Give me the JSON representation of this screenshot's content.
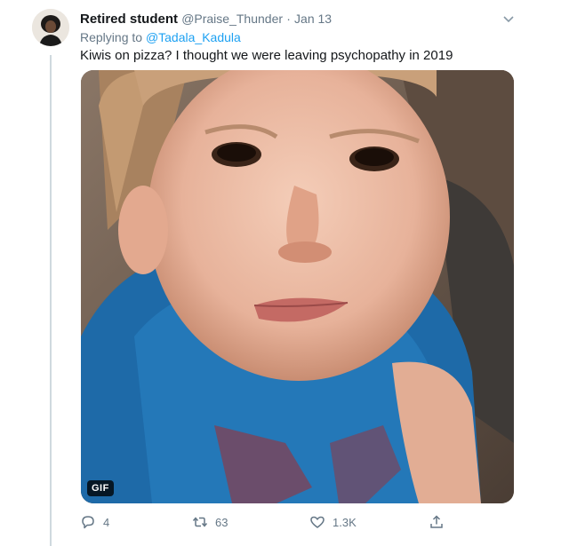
{
  "tweet": {
    "display_name": "Retired student",
    "handle": "@Praise_Thunder",
    "separator": "·",
    "date": "Jan 13",
    "reply_prefix": "Replying to",
    "reply_to": "@Tadala_Kadula",
    "text": "Kiwis on pizza? I thought we were leaving psychopathy in 2019",
    "media": {
      "badge": "GIF",
      "description_icon": "gif-media"
    }
  },
  "actions": {
    "reply_count": "4",
    "retweet_count": "63",
    "like_count": "1.3K",
    "share_label": ""
  },
  "icons": {
    "reply": "reply-icon",
    "retweet": "retweet-icon",
    "like": "heart-icon",
    "share": "share-icon",
    "menu": "chevron-down-icon"
  },
  "colors": {
    "text": "#14171a",
    "muted": "#657786",
    "link": "#1da1f2",
    "thread_line": "#cfd9de"
  }
}
